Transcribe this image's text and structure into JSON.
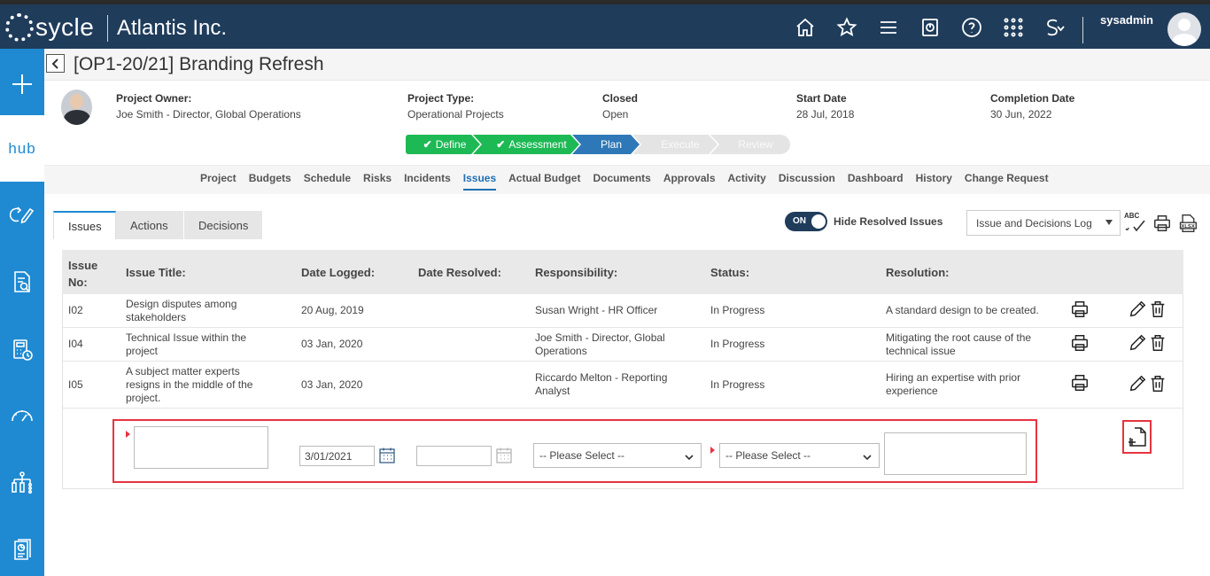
{
  "header": {
    "logo_text": "sycle",
    "company": "Atlantis Inc.",
    "username": "sysadmin",
    "icons": [
      "home-icon",
      "star-icon",
      "menu-icon",
      "dashboard-icon",
      "help-icon",
      "apps-grid-icon",
      "language-icon"
    ]
  },
  "sidebar": {
    "hub_label": "hub",
    "items": [
      "add-icon",
      "hub",
      "process-edit-icon",
      "document-search-icon",
      "calculator-clock-icon",
      "gauge-icon",
      "hierarchy-icon",
      "report-icon"
    ]
  },
  "page": {
    "title": "[OP1-20/21] Branding Refresh"
  },
  "project": {
    "owner_label": "Project Owner:",
    "owner_value": "Joe Smith - Director, Global Operations",
    "type_label": "Project Type:",
    "type_value": "Operational Projects",
    "closed_label": "Closed",
    "closed_value": "Open",
    "start_label": "Start Date",
    "start_value": "28 Jul, 2018",
    "completion_label": "Completion Date",
    "completion_value": "30 Jun, 2022"
  },
  "stages": [
    {
      "label": "Define",
      "state": "done"
    },
    {
      "label": "Assessment",
      "state": "done"
    },
    {
      "label": "Plan",
      "state": "current"
    },
    {
      "label": "Execute",
      "state": "pending"
    },
    {
      "label": "Review",
      "state": "pending"
    }
  ],
  "nav": {
    "links": [
      "Project",
      "Budgets",
      "Schedule",
      "Risks",
      "Incidents",
      "Issues",
      "Actual Budget",
      "Documents",
      "Approvals",
      "Activity",
      "Discussion",
      "Dashboard",
      "History",
      "Change Request"
    ],
    "active": "Issues"
  },
  "subtabs": {
    "items": [
      "Issues",
      "Actions",
      "Decisions"
    ],
    "active": "Issues"
  },
  "toolbar": {
    "toggle_state": "ON",
    "toggle_label": "Hide Resolved Issues",
    "report_select": "Issue and Decisions Log",
    "spellcheck_text": "ABC"
  },
  "table": {
    "headers": {
      "no_line1": "Issue",
      "no_line2": "No:",
      "title": "Issue Title:",
      "logged": "Date Logged:",
      "resolved": "Date Resolved:",
      "responsibility": "Responsibility:",
      "status": "Status:",
      "resolution": "Resolution:"
    },
    "rows": [
      {
        "no": "I02",
        "title_l1": "Design disputes among",
        "title_l2": "stakeholders",
        "title_l3": "",
        "logged": "20 Aug, 2019",
        "resolved": "",
        "resp_l1": "Susan Wright - HR Officer",
        "resp_l2": "",
        "status": "In Progress",
        "res_l1": "A standard design to be created.",
        "res_l2": ""
      },
      {
        "no": "I04",
        "title_l1": "Technical Issue within the",
        "title_l2": "project",
        "title_l3": "",
        "logged": "03 Jan, 2020",
        "resolved": "",
        "resp_l1": "Joe Smith - Director, Global",
        "resp_l2": "Operations",
        "status": "In Progress",
        "res_l1": "Mitigating the root cause of the",
        "res_l2": "technical issue"
      },
      {
        "no": "I05",
        "title_l1": "A subject matter experts",
        "title_l2": "resigns in the middle of the",
        "title_l3": "project.",
        "logged": "03 Jan, 2020",
        "resolved": "",
        "resp_l1": "Riccardo Melton - Reporting",
        "resp_l2": "Analyst",
        "status": "In Progress",
        "res_l1": "Hiring an expertise with prior",
        "res_l2": "experience"
      }
    ]
  },
  "new_row": {
    "title_value": "",
    "date_logged_value": "3/01/2021",
    "date_resolved_value": "",
    "responsibility_selected": "-- Please Select --",
    "status_selected": "-- Please Select --",
    "resolution_value": ""
  },
  "colors": {
    "topbar": "#1f3c5b",
    "sidebar": "#1f8ad1",
    "stage_done": "#1db954",
    "stage_current": "#2e78b7",
    "highlight": "#e5343f"
  }
}
